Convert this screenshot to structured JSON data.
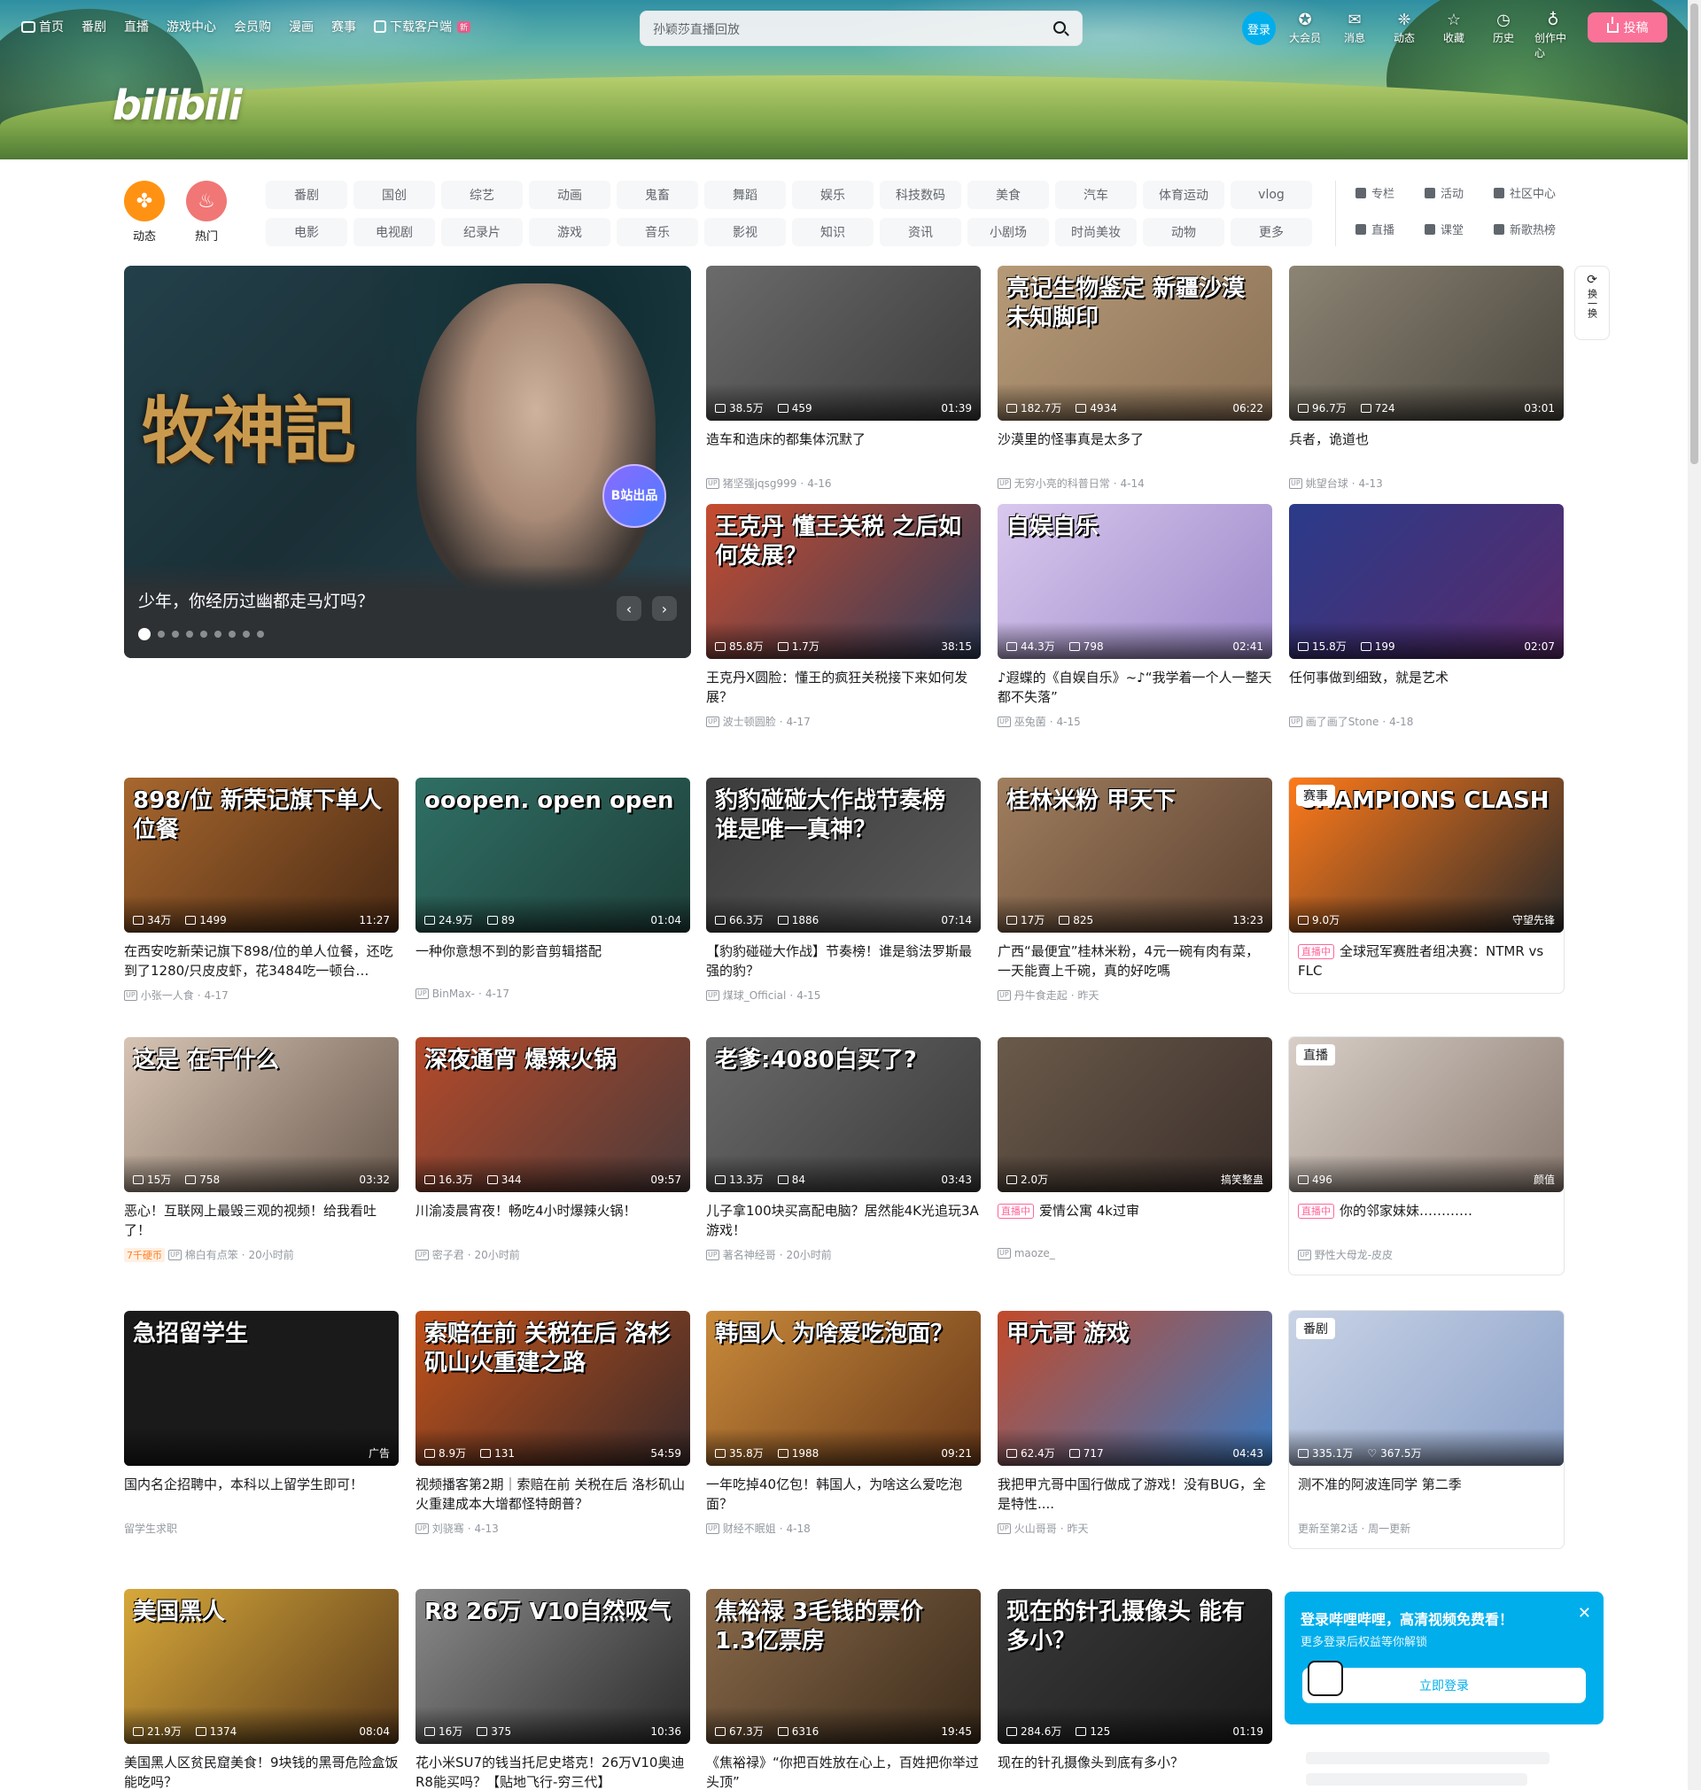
{
  "header": {
    "nav": [
      {
        "label": "首页",
        "icon": "tv-icon"
      },
      {
        "label": "番剧"
      },
      {
        "label": "直播"
      },
      {
        "label": "游戏中心"
      },
      {
        "label": "会员购"
      },
      {
        "label": "漫画"
      },
      {
        "label": "赛事"
      },
      {
        "label": "下载客户端",
        "icon": "download-icon",
        "badge": "新"
      }
    ],
    "logo": "bilibili",
    "search_placeholder": "孙颖莎直播回放",
    "login": "登录",
    "right_nav": [
      {
        "label": "大会员",
        "icon": "vip-icon",
        "glyph": "✪"
      },
      {
        "label": "消息",
        "icon": "message-icon",
        "glyph": "✉"
      },
      {
        "label": "动态",
        "icon": "wind-icon",
        "glyph": "❈"
      },
      {
        "label": "收藏",
        "icon": "star-icon",
        "glyph": "☆"
      },
      {
        "label": "历史",
        "icon": "clock-icon",
        "glyph": "◷"
      },
      {
        "label": "创作中心",
        "icon": "bulb-icon",
        "glyph": "♁"
      }
    ],
    "upload": "投稿"
  },
  "channels": {
    "primary": [
      {
        "label": "动态",
        "color": "#ff9212"
      },
      {
        "label": "热门",
        "color": "#f07775"
      }
    ],
    "tags": [
      "番剧",
      "国创",
      "综艺",
      "动画",
      "鬼畜",
      "舞蹈",
      "娱乐",
      "科技数码",
      "美食",
      "汽车",
      "体育运动",
      "vlog",
      "电影",
      "电视剧",
      "纪录片",
      "游戏",
      "音乐",
      "影视",
      "知识",
      "资讯",
      "小剧场",
      "时尚美妆",
      "动物",
      "更多"
    ],
    "side": [
      {
        "label": "专栏"
      },
      {
        "label": "活动"
      },
      {
        "label": "社区中心"
      },
      {
        "label": "直播"
      },
      {
        "label": "课堂"
      },
      {
        "label": "新歌热榜"
      }
    ]
  },
  "carousel": {
    "title": "少年，你经历过幽都走马灯吗？",
    "art_title": "牧神記",
    "badge": "B站出品",
    "dots": 9,
    "active_dot": 0
  },
  "refresh": {
    "label": "换一换"
  },
  "cards": [
    {
      "title": "造车和造床的都集体沉默了",
      "views": "38.5万",
      "danmaku": "459",
      "duration": "01:39",
      "author": "猪坚强jqsg999",
      "date": "4-16",
      "colors": [
        "#6b6b6b",
        "#3a3a3a"
      ],
      "art": ""
    },
    {
      "title": "沙漠里的怪事真是太多了",
      "views": "182.7万",
      "danmaku": "4934",
      "duration": "06:22",
      "author": "无穷小亮的科普日常",
      "date": "4-14",
      "colors": [
        "#b69a78",
        "#8a7055"
      ],
      "art": "亮记生物鉴定 新疆沙漠 未知脚印"
    },
    {
      "title": "兵者，诡道也",
      "views": "96.7万",
      "danmaku": "724",
      "duration": "03:01",
      "author": "姚望台球",
      "date": "4-13",
      "colors": [
        "#8c8474",
        "#4a463e"
      ],
      "art": ""
    },
    {
      "title": "王克丹X圆脸：懂王的疯狂关税接下来如何发展？",
      "views": "85.8万",
      "danmaku": "1.7万",
      "duration": "38:15",
      "author": "波士顿圆脸",
      "date": "4-17",
      "colors": [
        "#c74c2f",
        "#2f3c5a"
      ],
      "art": "王克丹 懂王关税 之后如何发展？"
    },
    {
      "title": "♪遐蝶的《自娱自乐》~♪“我学着一个人一整天都不失落”",
      "views": "44.3万",
      "danmaku": "798",
      "duration": "02:41",
      "author": "巫兔菌",
      "date": "4-15",
      "colors": [
        "#d9c8ee",
        "#9b88c9"
      ],
      "art": "自娱自乐"
    },
    {
      "title": "任何事做到细致，就是艺术",
      "views": "15.8万",
      "danmaku": "199",
      "duration": "02:07",
      "author": "画了画了Stone",
      "date": "4-18",
      "colors": [
        "#2a3b8a",
        "#5a2a6a"
      ],
      "art": ""
    },
    {
      "title": "在西安吃新荣记旗下898/位的单人位餐，还吃到了1280/只皮皮虾，花3484吃一顿台…",
      "views": "34万",
      "danmaku": "1499",
      "duration": "11:27",
      "author": "小张一人食",
      "date": "4-17",
      "colors": [
        "#a8672e",
        "#4a2a14"
      ],
      "art": "898/位 新荣记旗下单人位餐"
    },
    {
      "title": "一种你意想不到的影音剪辑搭配",
      "views": "24.9万",
      "danmaku": "89",
      "duration": "01:04",
      "author": "BinMax-",
      "date": "4-17",
      "colors": [
        "#2f6f64",
        "#1e3f3a"
      ],
      "art": "ooopen. open open"
    },
    {
      "title": "【豹豹碰碰大作战】节奏榜！谁是翁法罗斯最强的豹？",
      "views": "66.3万",
      "danmaku": "1886",
      "duration": "07:14",
      "author": "煤球_Official",
      "date": "4-15",
      "colors": [
        "#3c3c3c",
        "#5a5a5a"
      ],
      "art": "豹豹碰碰大作战节奏榜 谁是唯一真神？"
    },
    {
      "title": "广西“最便宜”桂林米粉，4元一碗有肉有菜，一天能賣上千碗，真的好吃嗎",
      "views": "17万",
      "danmaku": "825",
      "duration": "13:23",
      "author": "丹牛食走起",
      "date": "昨天",
      "colors": [
        "#a07e5e",
        "#5a4030"
      ],
      "art": "桂林米粉 甲天下"
    },
    {
      "title": "全球冠军赛胜者组决赛：NTMR vs FLC",
      "views": "9.0万",
      "duration": "守望先锋",
      "type": "赛事",
      "live": "直播中",
      "colors": [
        "#ff7a1a",
        "#2a2a2a"
      ],
      "art": "CHAMPIONS CLASH"
    },
    {
      "title": "恶心！互联网上最毁三观的视频！给我看吐了！",
      "views": "15万",
      "danmaku": "758",
      "duration": "03:32",
      "author": "棉白有点笨",
      "date": "20小时前",
      "coin": "7千硬币",
      "colors": [
        "#d7c4b4",
        "#6a5a4e"
      ],
      "art": "这是 在干什么"
    },
    {
      "title": "川渝凌晨宵夜！畅吃4小时爆辣火锅！",
      "views": "16.3万",
      "danmaku": "344",
      "duration": "09:57",
      "author": "密子君",
      "date": "20小时前",
      "colors": [
        "#b54a2a",
        "#4a3a3a"
      ],
      "art": "深夜通宵 爆辣火锅"
    },
    {
      "title": "儿子拿100块买高配电脑？居然能4K光追玩3A游戏！",
      "views": "13.3万",
      "danmaku": "84",
      "duration": "03:43",
      "author": "著名神经哥",
      "date": "20小时前",
      "colors": [
        "#6a6a6a",
        "#3a3a3a"
      ],
      "art": "老爹:4080白买了?"
    },
    {
      "title": "爱情公寓 4k过审",
      "views": "2.0万",
      "duration": "搞笑整蛊",
      "author": "maoze_",
      "live": "直播中",
      "colors": [
        "#6a5a4a",
        "#3a2e2a"
      ],
      "art": ""
    },
    {
      "title": "你的邻家妹妹…………",
      "views": "496",
      "duration": "颜值",
      "author": "野性大母龙-皮皮",
      "live": "直播中",
      "type": "直播",
      "colors": [
        "#d8cfc8",
        "#8a7a70"
      ],
      "art": ""
    },
    {
      "title": "国内名企招聘中，本科以上留学生即可！",
      "duration": "广告",
      "author": "留学生求职",
      "ad": true,
      "colors": [
        "#1a1a1a",
        "#1a1a1a"
      ],
      "art": "急招留学生"
    },
    {
      "title": "视频播客第2期｜索赔在前 关税在后 洛杉矶山火重建成本大增都怪特朗普？",
      "views": "8.9万",
      "danmaku": "131",
      "duration": "54:59",
      "author": "刘骁骞",
      "date": "4-13",
      "colors": [
        "#c2521a",
        "#3a2a2a"
      ],
      "art": "索赔在前 关税在后 洛杉矶山火重建之路"
    },
    {
      "title": "一年吃掉40亿包！韩国人，为啥这么爱吃泡面？",
      "views": "35.8万",
      "danmaku": "1988",
      "duration": "09:21",
      "author": "财经不眠姐",
      "date": "4-18",
      "colors": [
        "#c98a3a",
        "#6a3a1a"
      ],
      "art": "韩国人 为啥爱吃泡面？"
    },
    {
      "title": "我把甲亢哥中国行做成了游戏！没有BUG，全是特性....",
      "views": "62.4万",
      "danmaku": "717",
      "duration": "04:43",
      "author": "火山哥哥",
      "date": "昨天",
      "colors": [
        "#c24a2a",
        "#3a7ac2"
      ],
      "art": "甲亢哥 游戏"
    },
    {
      "title": "测不准的阿波连同学 第二季",
      "views": "335.1万",
      "likes": "367.5万",
      "type": "番剧",
      "author": "更新至第2话 · 周一更新",
      "colors": [
        "#c9d3e6",
        "#8aa0c8"
      ],
      "art": ""
    },
    {
      "title": "美国黑人区贫民窟美食！9块钱的黑哥危险盒饭能吃吗？",
      "views": "21.9万",
      "danmaku": "1374",
      "duration": "08:04",
      "colors": [
        "#d7a83a",
        "#5a3a1a"
      ],
      "art": "美国黑人"
    },
    {
      "title": "花小米SU7的钱当托尼史塔克！26万V10奥迪R8能买吗？【贴地飞行-穷三代】",
      "views": "16万",
      "danmaku": "375",
      "duration": "10:36",
      "colors": [
        "#8a8a8a",
        "#2a2a2a"
      ],
      "art": "R8 26万 V10自然吸气"
    },
    {
      "title": "《焦裕禄》“你把百姓放在心上，百姓把你举过头顶”",
      "views": "67.3万",
      "danmaku": "6316",
      "duration": "19:45",
      "colors": [
        "#8a6a4a",
        "#3a2a1a"
      ],
      "art": "焦裕禄 3毛钱的票价 1.3亿票房"
    },
    {
      "title": "现在的针孔摄像头到底有多小？",
      "views": "284.6万",
      "danmaku": "125",
      "duration": "01:19",
      "colors": [
        "#3a3a3a",
        "#1a1a1a"
      ],
      "art": "现在的针孔摄像头 能有多小？"
    }
  ],
  "login_popup": {
    "title": "登录哔哩哔哩，高清视频免费看！",
    "subtitle": "更多登录后权益等你解锁",
    "button": "立即登录"
  }
}
